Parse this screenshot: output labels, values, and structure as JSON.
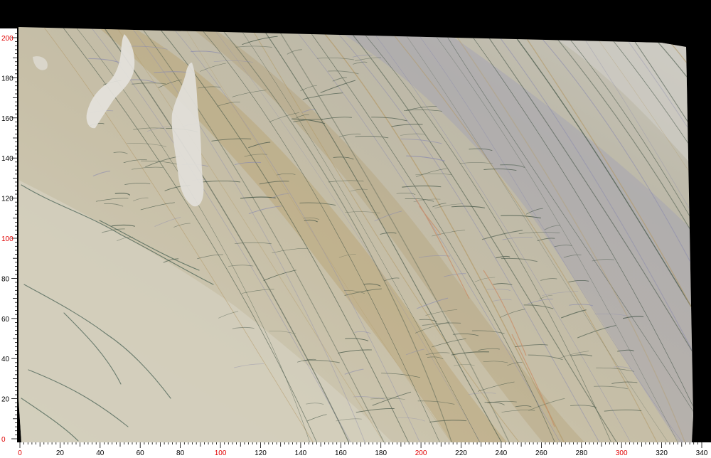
{
  "image": {
    "subject": "stone-slab",
    "background_color": "#000000"
  },
  "colors": {
    "ruler_background": "#ffffff",
    "ruler_text": "#000000",
    "ruler_highlight": "#e00000",
    "slab_base": "#c2b9a2",
    "slab_light": "#d2ccb8",
    "vein_dark": "#3f5143",
    "vein_ochre": "#b39a6a",
    "vein_violet": "#8c8cad",
    "vein_rust": "#c98a62",
    "inclusion_white": "#e4e2dc"
  },
  "ruler_bottom": {
    "labels": [
      "0",
      "20",
      "40",
      "60",
      "80",
      "100",
      "120",
      "140",
      "160",
      "180",
      "200",
      "220",
      "240",
      "260",
      "280",
      "300",
      "320",
      "340"
    ],
    "highlighted": [
      "0",
      "100",
      "200",
      "300"
    ]
  },
  "ruler_left": {
    "labels": [
      "0",
      "20",
      "40",
      "60",
      "80",
      "100",
      "120",
      "140",
      "160",
      "180",
      "200"
    ],
    "highlighted": [
      "0",
      "100",
      "200"
    ]
  }
}
